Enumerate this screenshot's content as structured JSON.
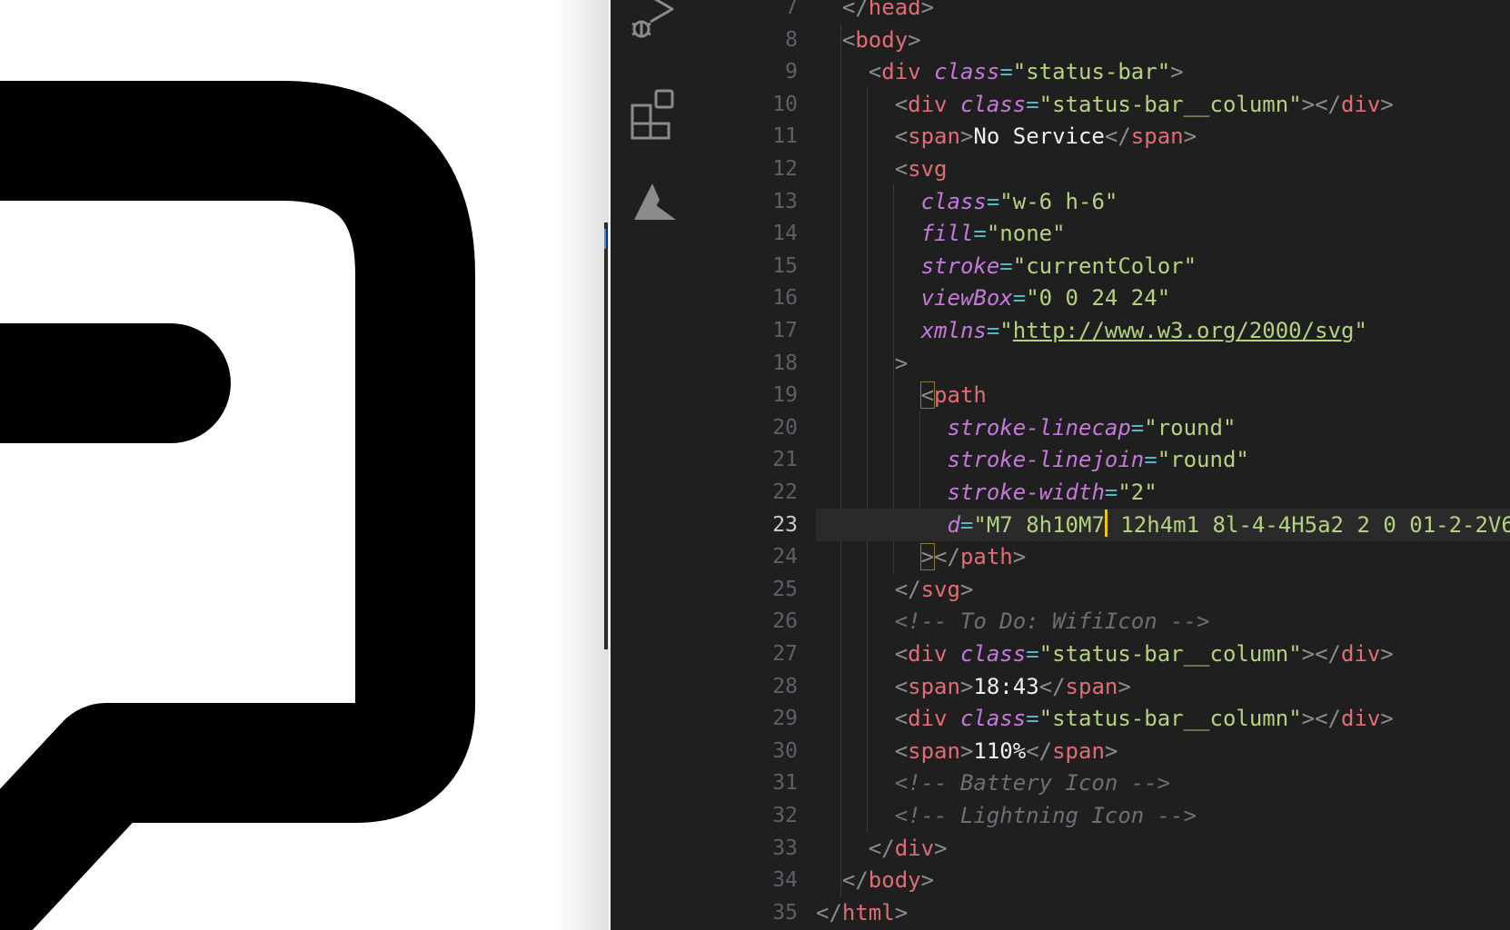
{
  "preview": {
    "icon": "chat-bubble-icon-zoomed"
  },
  "activity_bar": {
    "icons": [
      "run-debug-icon",
      "extensions-icon",
      "azure-icon"
    ]
  },
  "editor": {
    "current_line": "23",
    "lines": [
      {
        "n": "7",
        "open_close": "</",
        "tag": "head",
        "end": ">"
      },
      {
        "n": "8",
        "open_close": "<",
        "tag": "body",
        "end": ">"
      },
      {
        "n": "9",
        "tag": "div",
        "attr": "class",
        "value": "\"status-bar\""
      },
      {
        "n": "10",
        "tag": "div",
        "attr": "class",
        "value": "\"status-bar__column\"",
        "close_tag": "div"
      },
      {
        "n": "11",
        "tag": "span",
        "text": "No Service",
        "close_tag": "span"
      },
      {
        "n": "12",
        "tag": "svg"
      },
      {
        "n": "13",
        "attr": "class",
        "value": "\"w-6 h-6\""
      },
      {
        "n": "14",
        "attr": "fill",
        "value": "\"none\""
      },
      {
        "n": "15",
        "attr": "stroke",
        "value": "\"currentColor\""
      },
      {
        "n": "16",
        "attr": "viewBox",
        "value": "\"0 0 24 24\""
      },
      {
        "n": "17",
        "attr": "xmlns",
        "value": "http://www.w3.org/2000/svg"
      },
      {
        "n": "18",
        "text": ">"
      },
      {
        "n": "19",
        "tag": "path"
      },
      {
        "n": "20",
        "attr": "stroke-linecap",
        "value": "\"round\""
      },
      {
        "n": "21",
        "attr": "stroke-linejoin",
        "value": "\"round\""
      },
      {
        "n": "22",
        "attr": "stroke-width",
        "value": "\"2\""
      },
      {
        "n": "23",
        "attr": "d",
        "value_a": "\"M7 8h10M7",
        "value_b": " 12h4m1 8l-4-4H5a2 2 0 01-2-2V6"
      },
      {
        "n": "24",
        "close_tag": "path"
      },
      {
        "n": "25",
        "close_tag": "svg"
      },
      {
        "n": "26",
        "comment": "<!-- To Do: WifiIcon -->"
      },
      {
        "n": "27",
        "tag": "div",
        "attr": "class",
        "value": "\"status-bar__column\"",
        "close_tag": "div"
      },
      {
        "n": "28",
        "tag": "span",
        "text": "18:43",
        "close_tag": "span"
      },
      {
        "n": "29",
        "tag": "div",
        "attr": "class",
        "value": "\"status-bar__column\"",
        "close_tag": "div"
      },
      {
        "n": "30",
        "tag": "span",
        "text": "110%",
        "close_tag": "span"
      },
      {
        "n": "31",
        "comment": "<!-- Battery Icon -->"
      },
      {
        "n": "32",
        "comment": "<!-- Lightning Icon -->"
      },
      {
        "n": "33",
        "close_tag": "div"
      },
      {
        "n": "34",
        "close_tag": "body"
      },
      {
        "n": "35",
        "close_tag": "html"
      }
    ]
  },
  "colors": {
    "editor_bg": "#1f1f1f",
    "tag": "#e06c75",
    "attribute": "#c678dd",
    "string": "#b5d37e",
    "comment": "#6b6f76",
    "caret": "#f1c40f"
  }
}
